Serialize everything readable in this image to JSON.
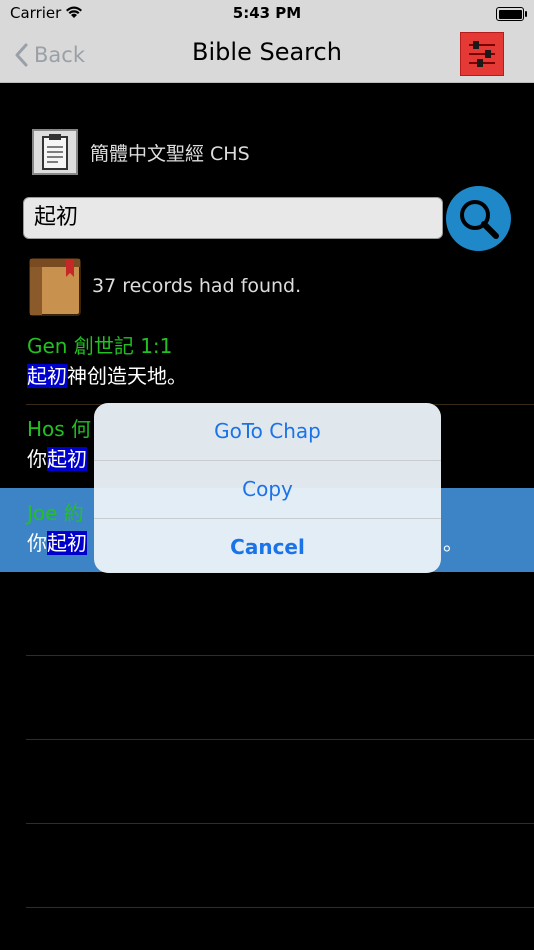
{
  "status": {
    "carrier": "Carrier",
    "time": "5:43 PM"
  },
  "nav": {
    "back_label": "Back",
    "title": "Bible Search"
  },
  "bible": {
    "name": "簡體中文聖經 CHS"
  },
  "search": {
    "value": "起初"
  },
  "result": {
    "text": "37 records had found."
  },
  "verses": [
    {
      "ref": "Gen 創世記 1:1",
      "hl": "起初",
      "prefix": "",
      "rest": "神创造天地。"
    },
    {
      "ref": "Hos 何",
      "hl": "起初",
      "prefix": "你",
      "rest": ""
    },
    {
      "ref": "Joe 約",
      "hl": "起初",
      "prefix": "你",
      "rest": "",
      "tail": "。"
    }
  ],
  "sheet": {
    "goto": "GoTo Chap",
    "copy": "Copy",
    "cancel": "Cancel"
  },
  "colors": {
    "accent": "#1a73e8",
    "reference": "#22c022",
    "selection": "#3d84c6",
    "highlight": "#0000cc"
  },
  "icons": {
    "wifi": "wifi-icon",
    "battery": "battery-icon",
    "back": "chevron-left-icon",
    "settings": "sliders-icon",
    "bible": "clipboard-icon",
    "search": "magnifier-icon",
    "result": "book-icon"
  }
}
